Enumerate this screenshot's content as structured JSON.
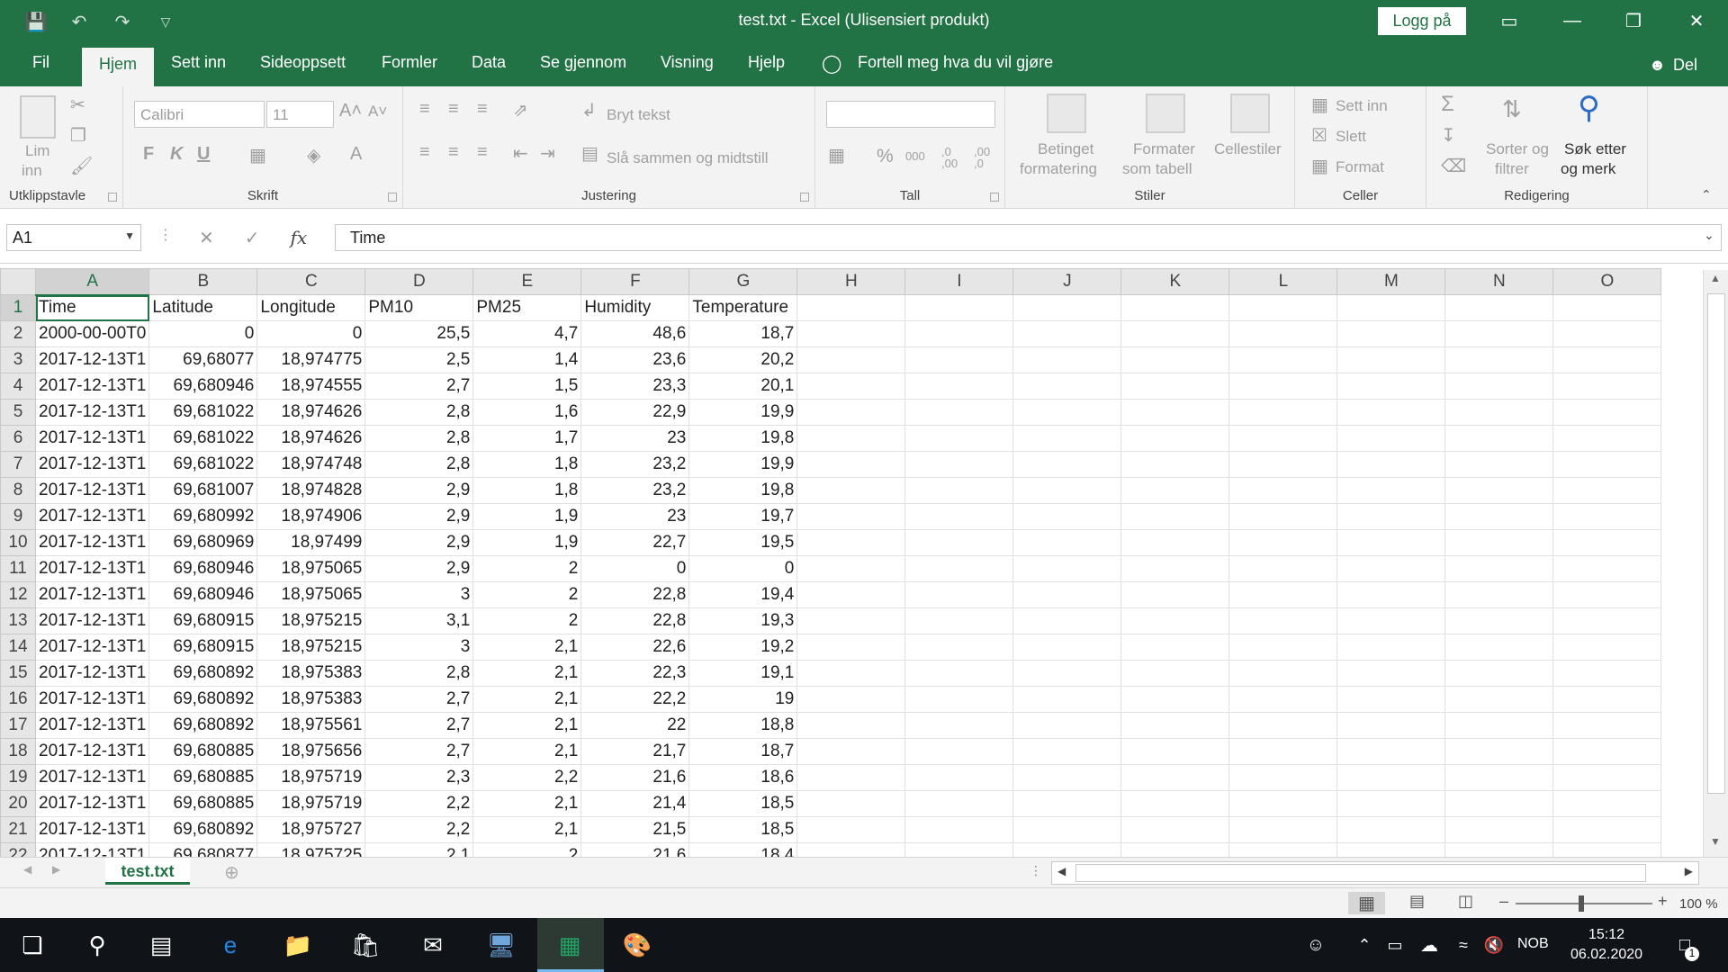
{
  "window": {
    "title": "test.txt  -  Excel (Ulisensiert produkt)",
    "login_label": "Logg på",
    "controls": [
      "ribbon-display-icon",
      "minimize-icon",
      "restore-icon",
      "close-icon"
    ]
  },
  "tabs": {
    "items": [
      "Fil",
      "Hjem",
      "Sett inn",
      "Sideoppsett",
      "Formler",
      "Data",
      "Se gjennom",
      "Visning",
      "Hjelp"
    ],
    "active": "Hjem",
    "tell_me": "Fortell meg hva du vil gjøre",
    "share": "Del"
  },
  "ribbon": {
    "clipboard": {
      "label": "Utklippstavle",
      "paste": "Lim",
      "paste2": "inn"
    },
    "font": {
      "label": "Skrift",
      "font_name": "Calibri",
      "font_size": "11",
      "bold": "F",
      "italic": "K",
      "underline": "U"
    },
    "alignment": {
      "label": "Justering",
      "wrap_text": "Bryt tekst",
      "merge_center": "Slå sammen og midtstill"
    },
    "number": {
      "label": "Tall",
      "format": "",
      "percent": "%",
      "comma": "000",
      "inc_dec": ",0 ,00",
      "dec_dec": ",00 ,0"
    },
    "styles": {
      "label": "Stiler",
      "conditional": "Betinget",
      "conditional2": "formatering",
      "format_table": "Formater",
      "format_table2": "som tabell",
      "cell_styles": "Cellestiler"
    },
    "cells": {
      "label": "Celler",
      "insert": "Sett inn",
      "delete": "Slett",
      "format": "Format"
    },
    "editing": {
      "label": "Redigering",
      "sort": "Sorter og",
      "sort2": "filtrer",
      "find": "Søk etter",
      "find2": "og merk"
    }
  },
  "formula_bar": {
    "name_box": "A1",
    "fx": "fx",
    "value": "Time"
  },
  "sheet": {
    "columns": [
      "A",
      "B",
      "C",
      "D",
      "E",
      "F",
      "G",
      "H",
      "I",
      "J",
      "K",
      "L",
      "M",
      "N",
      "O"
    ],
    "headers": [
      "Time",
      "Latitude",
      "Longitude",
      "PM10",
      "PM25",
      "Humidity",
      "Temperature"
    ],
    "rows": [
      [
        "2000-00-00T0",
        "0",
        "0",
        "25,5",
        "4,7",
        "48,6",
        "18,7"
      ],
      [
        "2017-12-13T1",
        "69,68077",
        "18,974775",
        "2,5",
        "1,4",
        "23,6",
        "20,2"
      ],
      [
        "2017-12-13T1",
        "69,680946",
        "18,974555",
        "2,7",
        "1,5",
        "23,3",
        "20,1"
      ],
      [
        "2017-12-13T1",
        "69,681022",
        "18,974626",
        "2,8",
        "1,6",
        "22,9",
        "19,9"
      ],
      [
        "2017-12-13T1",
        "69,681022",
        "18,974626",
        "2,8",
        "1,7",
        "23",
        "19,8"
      ],
      [
        "2017-12-13T1",
        "69,681022",
        "18,974748",
        "2,8",
        "1,8",
        "23,2",
        "19,9"
      ],
      [
        "2017-12-13T1",
        "69,681007",
        "18,974828",
        "2,9",
        "1,8",
        "23,2",
        "19,8"
      ],
      [
        "2017-12-13T1",
        "69,680992",
        "18,974906",
        "2,9",
        "1,9",
        "23",
        "19,7"
      ],
      [
        "2017-12-13T1",
        "69,680969",
        "18,97499",
        "2,9",
        "1,9",
        "22,7",
        "19,5"
      ],
      [
        "2017-12-13T1",
        "69,680946",
        "18,975065",
        "2,9",
        "2",
        "0",
        "0"
      ],
      [
        "2017-12-13T1",
        "69,680946",
        "18,975065",
        "3",
        "2",
        "22,8",
        "19,4"
      ],
      [
        "2017-12-13T1",
        "69,680915",
        "18,975215",
        "3,1",
        "2",
        "22,8",
        "19,3"
      ],
      [
        "2017-12-13T1",
        "69,680915",
        "18,975215",
        "3",
        "2,1",
        "22,6",
        "19,2"
      ],
      [
        "2017-12-13T1",
        "69,680892",
        "18,975383",
        "2,8",
        "2,1",
        "22,3",
        "19,1"
      ],
      [
        "2017-12-13T1",
        "69,680892",
        "18,975383",
        "2,7",
        "2,1",
        "22,2",
        "19"
      ],
      [
        "2017-12-13T1",
        "69,680892",
        "18,975561",
        "2,7",
        "2,1",
        "22",
        "18,8"
      ],
      [
        "2017-12-13T1",
        "69,680885",
        "18,975656",
        "2,7",
        "2,1",
        "21,7",
        "18,7"
      ],
      [
        "2017-12-13T1",
        "69,680885",
        "18,975719",
        "2,3",
        "2,2",
        "21,6",
        "18,6"
      ],
      [
        "2017-12-13T1",
        "69,680885",
        "18,975719",
        "2,2",
        "2,1",
        "21,4",
        "18,5"
      ],
      [
        "2017-12-13T1",
        "69,680892",
        "18,975727",
        "2,2",
        "2,1",
        "21,5",
        "18,5"
      ],
      [
        "2017-12-13T1",
        "69,680877",
        "18,975725",
        "2,1",
        "2",
        "21,6",
        "18,4"
      ]
    ],
    "tab_name": "test.txt"
  },
  "status": {
    "zoom": "100 %"
  },
  "taskbar": {
    "time": "15:12",
    "date": "06.02.2020",
    "lang": "NOB",
    "notifications": "1"
  }
}
